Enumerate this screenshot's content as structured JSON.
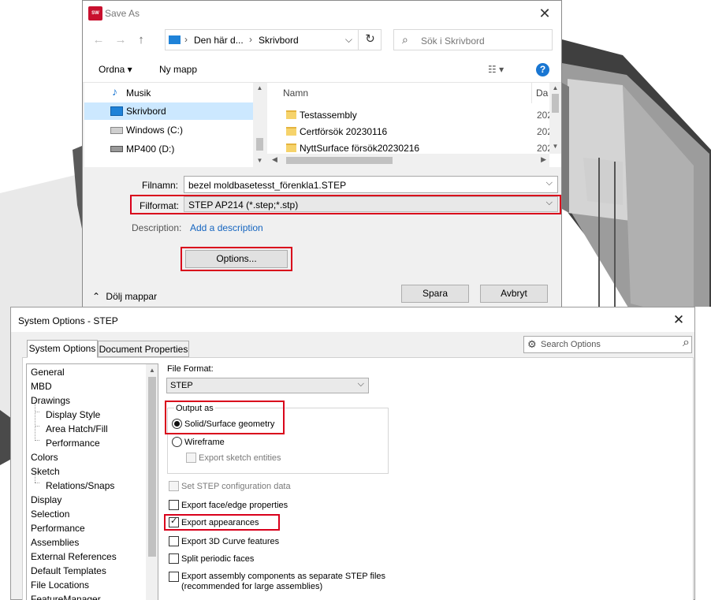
{
  "save_dialog": {
    "title": "Save As",
    "app_icon_text": "SW 2023",
    "address": {
      "crumb1": "Den här d...",
      "crumb2": "Skrivbord"
    },
    "search_placeholder": "Sök i Skrivbord",
    "toolbar": {
      "organize": "Ordna ▾",
      "new_folder": "Ny mapp",
      "help": "?"
    },
    "nav_items": [
      {
        "label": "Musik"
      },
      {
        "label": "Skrivbord"
      },
      {
        "label": "Windows  (C:)"
      },
      {
        "label": "MP400 (D:)"
      }
    ],
    "columns": {
      "name": "Namn",
      "date": "Da"
    },
    "files": [
      {
        "name": "Testassembly",
        "date": "202"
      },
      {
        "name": "Certförsök 20230116",
        "date": "202"
      },
      {
        "name": "NyttSurface försök20230216",
        "date": "202"
      }
    ],
    "filename_label": "Filnamn:",
    "filename_value": "bezel moldbasetesst_förenkla1.STEP",
    "format_label": "Filformat:",
    "format_value": "STEP AP214 (*.step;*.stp)",
    "description_label": "Description:",
    "description_link": "Add a description",
    "options_button": "Options...",
    "hide_folders": "Dölj mappar",
    "save_button": "Spara",
    "cancel_button": "Avbryt"
  },
  "options_dialog": {
    "title": "System Options - STEP",
    "tabs": [
      "System Options",
      "Document Properties"
    ],
    "search_placeholder": "Search Options",
    "tree": [
      "General",
      "MBD",
      "Drawings",
      "Display Style",
      "Area Hatch/Fill",
      "Performance",
      "Colors",
      "Sketch",
      "Relations/Snaps",
      "Display",
      "Selection",
      "Performance",
      "Assemblies",
      "External References",
      "Default Templates",
      "File Locations",
      "FeatureManager"
    ],
    "file_format_label": "File Format:",
    "file_format_value": "STEP",
    "output_as_label": "Output as",
    "radio_solid": "Solid/Surface geometry",
    "radio_wireframe": "Wireframe",
    "export_sketch": "Export sketch entities",
    "set_config": "Set STEP configuration data",
    "export_face_edge": "Export face/edge properties",
    "export_appearances": "Export appearances",
    "export_3d_curve": "Export 3D Curve features",
    "split_periodic": "Split periodic faces",
    "export_assembly_line1": "Export assembly components as separate STEP files",
    "export_assembly_line2": "(recommended for large assemblies)"
  }
}
